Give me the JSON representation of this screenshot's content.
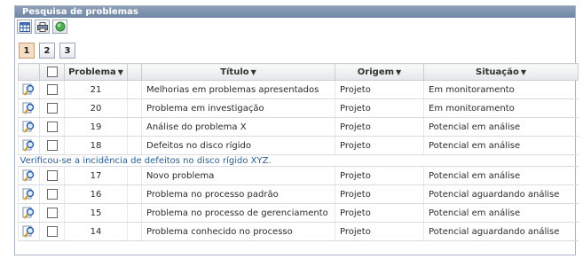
{
  "panel": {
    "title": "Pesquisa de problemas"
  },
  "pager": [
    "1",
    "2",
    "3"
  ],
  "columns": {
    "problema": "Problema",
    "titulo": "Título",
    "origem": "Origem",
    "situacao": "Situação"
  },
  "rows": [
    {
      "num": "21",
      "titulo": "Melhorias em problemas apresentados",
      "origem": "Projeto",
      "situacao": "Em monitoramento"
    },
    {
      "num": "20",
      "titulo": "Problema em investigação",
      "origem": "Projeto",
      "situacao": "Em monitoramento"
    },
    {
      "num": "19",
      "titulo": "Análise do problema X",
      "origem": "Projeto",
      "situacao": "Potencial em análise"
    },
    {
      "num": "18",
      "titulo": "Defeitos no disco rígido",
      "origem": "Projeto",
      "situacao": "Potencial em análise"
    },
    {
      "num": "17",
      "titulo": "Novo problema",
      "origem": "Projeto",
      "situacao": "Potencial em análise"
    },
    {
      "num": "16",
      "titulo": "Problema no processo padrão",
      "origem": "Projeto",
      "situacao": "Potencial aguardando análise"
    },
    {
      "num": "15",
      "titulo": "Problema no processo de gerenciamento",
      "origem": "Projeto",
      "situacao": "Potencial em análise"
    },
    {
      "num": "14",
      "titulo": "Problema conhecido no processo",
      "origem": "Projeto",
      "situacao": "Potencial aguardando análise"
    }
  ],
  "note": "Verificou-se a incidência de defeitos no disco rígido XYZ."
}
